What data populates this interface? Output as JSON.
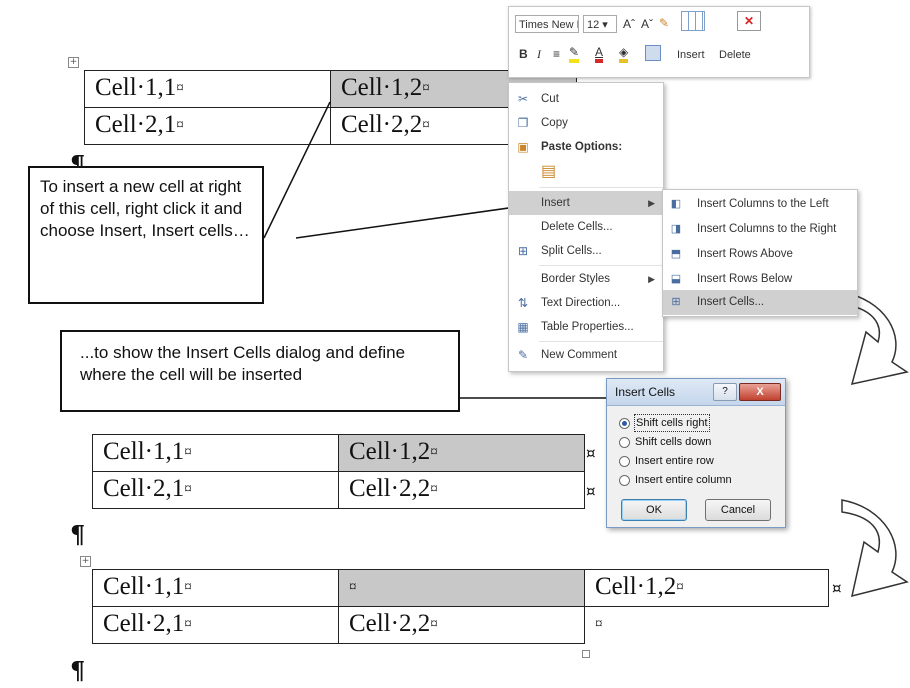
{
  "minibar": {
    "font_name": "Times New Ro",
    "font_size": "12",
    "grow_font": "Aˆ",
    "shrink_font": "Aˇ",
    "bold": "B",
    "italic": "I",
    "insert_label": "Insert",
    "delete_label": "Delete"
  },
  "context_menu": {
    "items": [
      {
        "label": "Cut",
        "icon": "scissors-icon"
      },
      {
        "label": "Copy",
        "icon": "copy-icon"
      },
      {
        "label": "Paste Options:",
        "icon": "paste-icon"
      },
      {
        "label": "Insert",
        "icon": ""
      },
      {
        "label": "Delete Cells...",
        "icon": ""
      },
      {
        "label": "Split Cells...",
        "icon": "split-cells-icon"
      },
      {
        "label": "Border Styles",
        "icon": ""
      },
      {
        "label": "Text Direction...",
        "icon": "text-direction-icon"
      },
      {
        "label": "Table Properties...",
        "icon": "table-properties-icon"
      },
      {
        "label": "New Comment",
        "icon": "comment-icon"
      }
    ]
  },
  "submenu": {
    "items": [
      {
        "label": "Insert Columns to the Left"
      },
      {
        "label": "Insert Columns to the Right"
      },
      {
        "label": "Insert Rows Above"
      },
      {
        "label": "Insert Rows Below"
      },
      {
        "label": "Insert Cells..."
      }
    ]
  },
  "callouts": {
    "first": "To insert a new cell at right of this cell, right click it and choose Insert, Insert cells…",
    "second": "...to show the Insert Cells dialog and define where the cell will be inserted"
  },
  "dialog": {
    "title": "Insert Cells",
    "help": "?",
    "close": "X",
    "options": [
      {
        "label": "Shift cells right",
        "checked": true
      },
      {
        "label": "Shift cells down",
        "checked": false
      },
      {
        "label": "Insert entire row",
        "checked": false
      },
      {
        "label": "Insert entire column",
        "checked": false
      }
    ],
    "ok_label": "OK",
    "cancel_label": "Cancel"
  },
  "tables": {
    "table1": {
      "r1c1": "Cell·1,1",
      "r1c2": "Cell·1,2",
      "r2c1": "Cell·2,1",
      "r2c2": "Cell·2,2"
    },
    "table2": {
      "r1c1": "Cell·1,1",
      "r1c2": "Cell·1,2",
      "r2c1": "Cell·2,1",
      "r2c2": "Cell·2,2"
    },
    "table3": {
      "r1c1": "Cell·1,1",
      "r1c2": "",
      "r1c3": "Cell·1,2",
      "r2c1": "Cell·2,1",
      "r2c2": "Cell·2,2",
      "r2c3": ""
    }
  },
  "marks": {
    "cell_end": "¤",
    "pilcrow": "¶",
    "move_handle": "+"
  },
  "colors": {
    "selected_cell": "#c8c8c8",
    "menu_highlight": "#d0d0d0",
    "dialog_close": "#c1412f"
  }
}
